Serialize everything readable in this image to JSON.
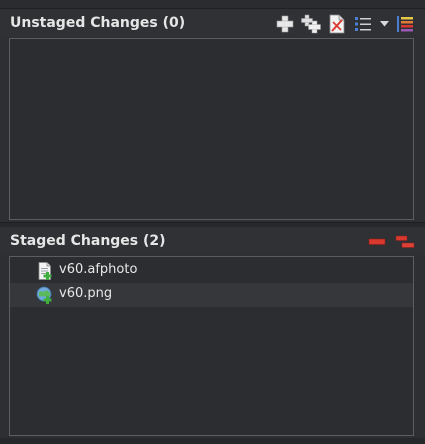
{
  "unstaged": {
    "title": "Unstaged Changes (0)",
    "toolbar": [
      {
        "icon": "stage-icon"
      },
      {
        "icon": "stage-all-icon"
      },
      {
        "icon": "discard-icon"
      },
      {
        "icon": "list-view-icon"
      },
      {
        "icon": "dropdown-arrow-icon"
      },
      {
        "icon": "sort-icon"
      }
    ]
  },
  "staged": {
    "title": "Staged Changes (2)",
    "toolbar": [
      {
        "icon": "unstage-icon"
      },
      {
        "icon": "unstage-all-icon"
      }
    ],
    "files": [
      {
        "name": "v60.afphoto",
        "icon": "document-added-icon"
      },
      {
        "name": "v60.png",
        "icon": "image-added-icon"
      }
    ]
  },
  "colors": {
    "background": "#2d2f32",
    "panel": "#2b2d30",
    "border": "#5b5d60",
    "text": "#e6e6e6",
    "remove_red": "#d9382f",
    "add_green": "#3fae3f"
  }
}
